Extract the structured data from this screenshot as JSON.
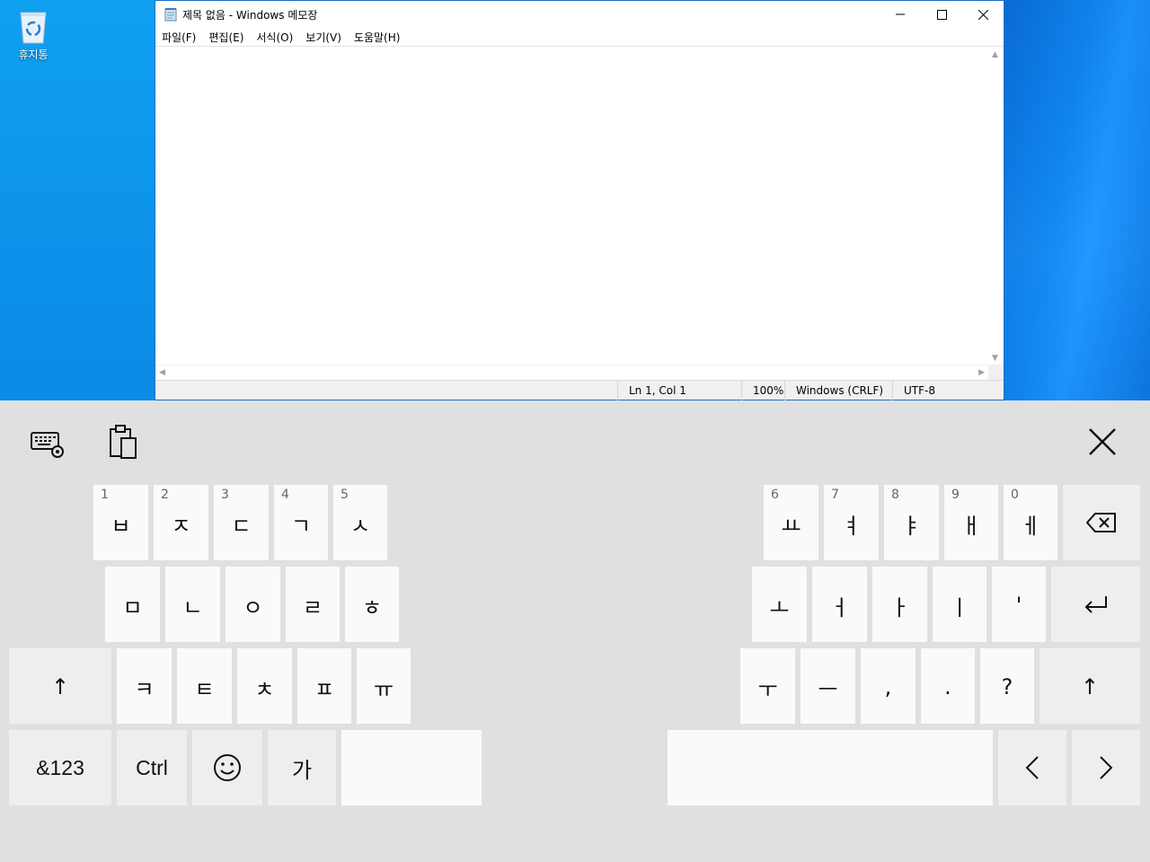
{
  "desktop": {
    "recycle_bin_label": "휴지통"
  },
  "notepad": {
    "title": "제목 없음 - Windows 메모장",
    "menu": [
      "파일(F)",
      "편집(E)",
      "서식(O)",
      "보기(V)",
      "도움말(H)"
    ],
    "status": {
      "position": "Ln 1, Col 1",
      "zoom": "100%",
      "line_ending": "Windows (CRLF)",
      "encoding": "UTF-8"
    }
  },
  "keyboard": {
    "row1_left": [
      {
        "hint": "1",
        "char": "ㅂ"
      },
      {
        "hint": "2",
        "char": "ㅈ"
      },
      {
        "hint": "3",
        "char": "ㄷ"
      },
      {
        "hint": "4",
        "char": "ㄱ"
      },
      {
        "hint": "5",
        "char": "ㅅ"
      }
    ],
    "row1_right": [
      {
        "hint": "6",
        "char": "ㅛ"
      },
      {
        "hint": "7",
        "char": "ㅕ"
      },
      {
        "hint": "8",
        "char": "ㅑ"
      },
      {
        "hint": "9",
        "char": "ㅐ"
      },
      {
        "hint": "0",
        "char": "ㅔ"
      }
    ],
    "row2_left": [
      "ㅁ",
      "ㄴ",
      "ㅇ",
      "ㄹ",
      "ㅎ"
    ],
    "row2_right": [
      "ㅗ",
      "ㅓ",
      "ㅏ",
      "ㅣ",
      "'"
    ],
    "row3_left": [
      "ㅋ",
      "ㅌ",
      "ㅊ",
      "ㅍ",
      "ㅠ"
    ],
    "row3_right": [
      "ㅜ",
      "ㅡ",
      ",",
      ".",
      "?"
    ],
    "symbols_label": "&123",
    "ctrl_label": "Ctrl",
    "hangul_label": "가",
    "shift_glyph": "↑",
    "left_arrow_glyph": "‹",
    "right_arrow_glyph": "›"
  }
}
